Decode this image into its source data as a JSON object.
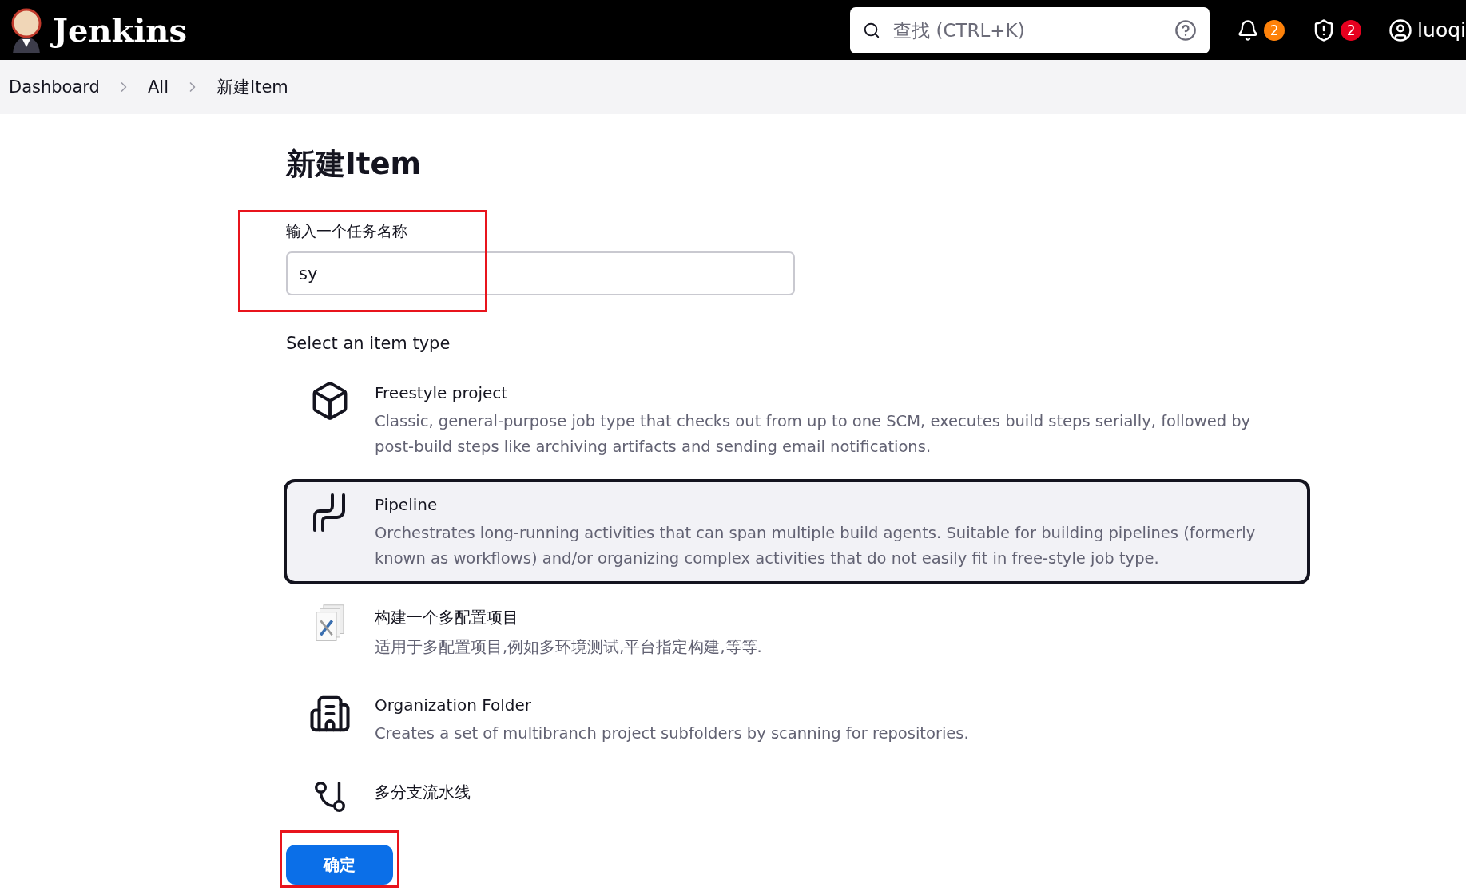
{
  "header": {
    "logo_text": "Jenkins",
    "search": {
      "placeholder": "查找 (CTRL+K)"
    },
    "notifications_badge": "2",
    "security_badge": "2",
    "user": "luoqi"
  },
  "breadcrumbs": [
    "Dashboard",
    "All",
    "新建Item"
  ],
  "title": "新建Item",
  "name_field": {
    "label": "输入一个任务名称",
    "value": "sy"
  },
  "item_types_heading": "Select an item type",
  "item_types": [
    {
      "kind": "freestyle",
      "title": "Freestyle project",
      "description": "Classic, general-purpose job type that checks out from up to one SCM, executes build steps serially, followed by post-build steps like archiving artifacts and sending email notifications.",
      "selected": false
    },
    {
      "kind": "pipeline",
      "title": "Pipeline",
      "description": "Orchestrates long-running activities that can span multiple build agents. Suitable for building pipelines (formerly known as workflows) and/or organizing complex activities that do not easily fit in free-style job type.",
      "selected": true
    },
    {
      "kind": "matrix",
      "title": "构建一个多配置项目",
      "description": "适用于多配置项目,例如多环境测试,平台指定构建,等等.",
      "selected": false
    },
    {
      "kind": "folder",
      "title": "Organization Folder",
      "description": "Creates a set of multibranch project subfolders by scanning for repositories.",
      "selected": false
    },
    {
      "kind": "branch",
      "title": "多分支流水线",
      "selected": false
    }
  ],
  "submit_button": "确定"
}
